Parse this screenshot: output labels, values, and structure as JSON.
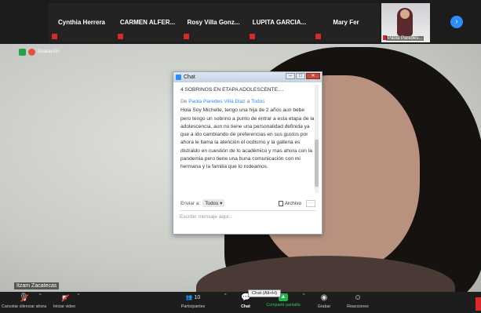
{
  "participants": [
    {
      "name": "Cynthia Herrera",
      "muted": true
    },
    {
      "name": "CARMEN ALFER...",
      "muted": true
    },
    {
      "name": "Rosy Villa Gonz...",
      "muted": true
    },
    {
      "name": "LUPITA GARCIA...",
      "muted": true
    },
    {
      "name": "Mary Fer",
      "muted": true
    }
  ],
  "photo_participant": {
    "name": "Paola Paredes...",
    "muted": true
  },
  "recording": {
    "label": "Grabación"
  },
  "self_view": {
    "name": "Itzam Zacatecas"
  },
  "chat": {
    "window_title": "Chat",
    "previous_message": "4 SOBRINOS EN ETAPA ADOLESCENTE....",
    "sender_prefix": "De",
    "sender_name": "Paola Paredes Villa Diaz",
    "recipient_prefix": "a",
    "recipient": "Todos",
    "message": "Hola Soy Michelle, tengo una hija de 2 años aun bebe pero tengo un sobrino a punto de entrar a esta etapa de la adolescencia, aun no tiene una personalidad definida ya que a ido cambiando de preferencias en sus gustos por ahora le llama la atención el ocdismo y la galleria es distraido en cuestión de lo académico y mas ahora con la pandemia pero tiene una buna comunicación con mi hermana y la familia que lo rodeamos.",
    "send_to_label": "Enviar a:",
    "send_to_value": "Todos",
    "file_label": "Archivo",
    "more_label": "···",
    "input_placeholder": "Escribir mensaje aquí..."
  },
  "tooltip": "Chat (Alt+H)",
  "toolbar": {
    "mute": "Cancelar silenciar ahora",
    "video": "Iniciar video",
    "participants": "Participantes",
    "participants_count": "10",
    "chat": "Chat",
    "share": "Compartir pantalla",
    "record": "Grabar",
    "reactions": "Reacciones"
  },
  "colors": {
    "accent": "#2d8cff",
    "mute_red": "#d9292b",
    "share_green": "#22b14c"
  }
}
